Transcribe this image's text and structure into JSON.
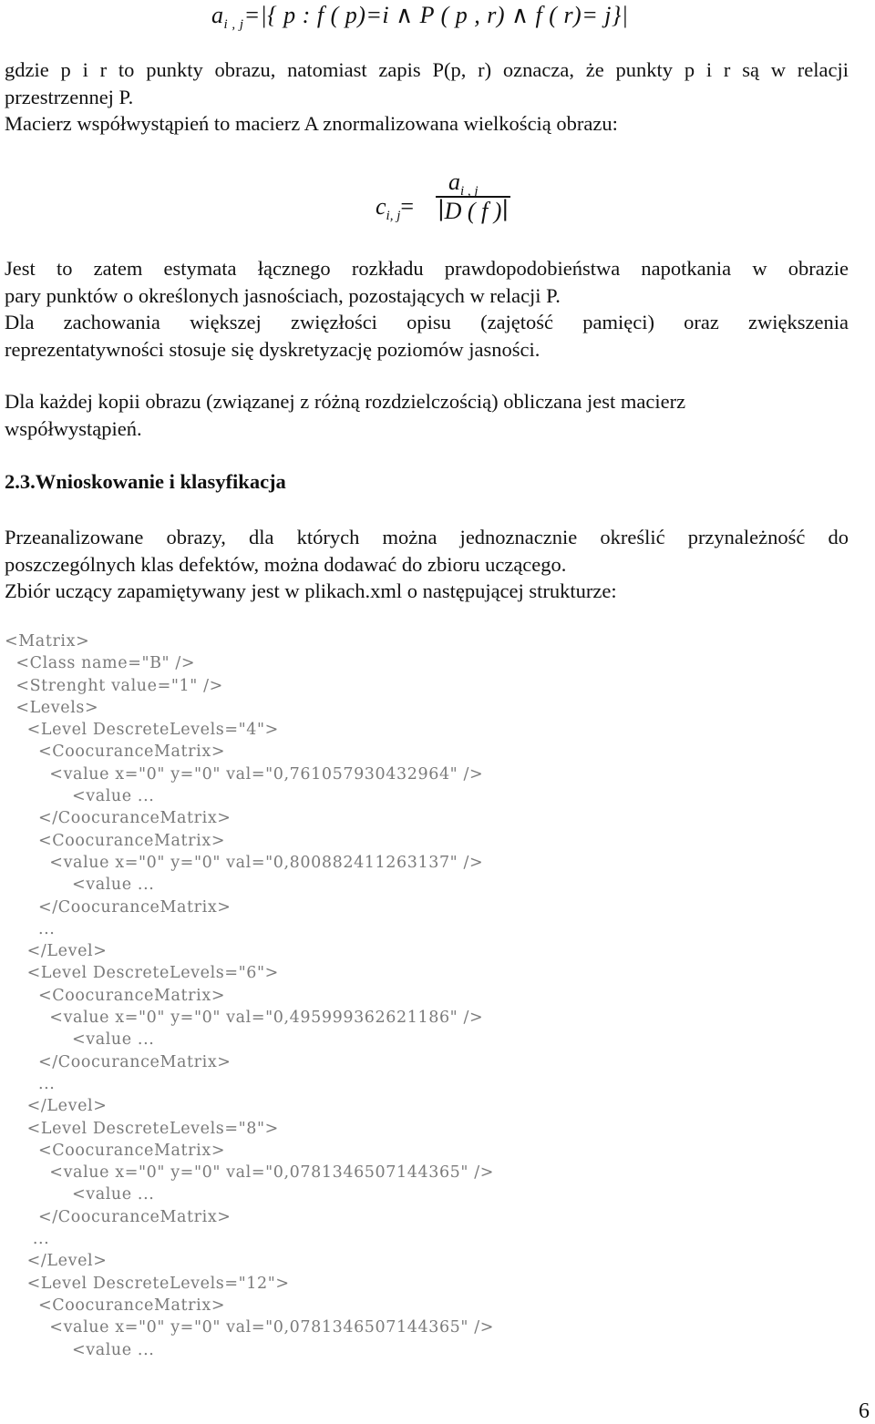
{
  "formula_cooccurrence": {
    "lhs": "a",
    "lhs_sub": "i , j",
    "rhs": "=|{ p : f ( p)=i ∧ P ( p , r) ∧ f ( r)= j}|"
  },
  "paragraph_1": {
    "lines": [
      "gdzie p i r to punkty obrazu, natomiast zapis P(p, r) oznacza, że punkty p i r są w relacji",
      "przestrzennej P.",
      "Macierz współwystąpień to macierz A znormalizowana wielkością obrazu:"
    ]
  },
  "formula_normalized": {
    "lhs": "c",
    "lhs_sub": "i, j",
    "equals": "=",
    "numerator": "a",
    "numerator_sub": "i , j",
    "denominator": "∣D ( f )∣"
  },
  "paragraph_2": {
    "lines": [
      "Jest to zatem estymata łącznego rozkładu prawdopodobieństwa napotkania w obrazie",
      "pary punktów o określonych jasnościach, pozostających w relacji P.",
      "Dla zachowania większej zwięzłości opisu (zajętość pamięci) oraz zwiększenia",
      "reprezentatywności stosuje się dyskretyzację poziomów jasności."
    ]
  },
  "paragraph_3": {
    "lines": [
      "Dla każdej kopii obrazu (związanej z różną rozdzielczością) obliczana jest macierz",
      "współwystąpień."
    ]
  },
  "section_heading": "2.3.Wnioskowanie i klasyfikacja",
  "paragraph_4": {
    "lines": [
      "Przeanalizowane obrazy, dla których można jednoznacznie określić przynależność do",
      "poszczególnych klas defektów, można dodawać do zbioru uczącego.",
      "Zbiór uczący zapamiętywany jest w plikach.xml o następującej strukturze:"
    ]
  },
  "xml_listing": [
    "<Matrix>",
    "  <Class name=\"B\" />",
    "  <Strenght value=\"1\" />",
    "  <Levels>",
    "    <Level DescreteLevels=\"4\">",
    "      <CoocuranceMatrix>",
    "        <value x=\"0\" y=\"0\" val=\"0,761057930432964\" />",
    "            <value ...",
    "      </CoocuranceMatrix>",
    "      <CoocuranceMatrix>",
    "        <value x=\"0\" y=\"0\" val=\"0,800882411263137\" />",
    "            <value ...",
    "      </CoocuranceMatrix>",
    "      ...",
    "    </Level>",
    "    <Level DescreteLevels=\"6\">",
    "      <CoocuranceMatrix>",
    "        <value x=\"0\" y=\"0\" val=\"0,495999362621186\" />",
    "            <value ...",
    "      </CoocuranceMatrix>",
    "      ...",
    "    </Level>",
    "    <Level DescreteLevels=\"8\">",
    "      <CoocuranceMatrix>",
    "        <value x=\"0\" y=\"0\" val=\"0,0781346507144365\" />",
    "            <value ...",
    "      </CoocuranceMatrix>",
    "     ...",
    "    </Level>",
    "    <Level DescreteLevels=\"12\">",
    "      <CoocuranceMatrix>",
    "        <value x=\"0\" y=\"0\" val=\"0,0781346507144365\" />",
    "            <value ..."
  ],
  "page_number": "6"
}
